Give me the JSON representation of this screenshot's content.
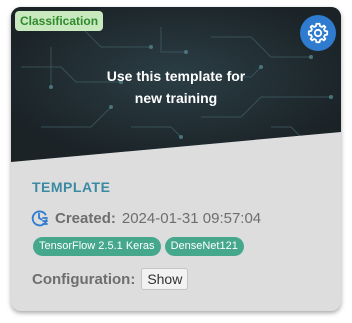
{
  "card": {
    "badge": "Classification",
    "banner_text_line1": "Use this template for",
    "banner_text_line2": "new training",
    "settings_icon": "gear-icon",
    "title": "TEMPLATE",
    "created_label": "Created:",
    "created_value": "2024-01-31 09:57:04",
    "created_icon": "clock-list-icon",
    "tags": [
      "TensorFlow 2.5.1 Keras",
      "DenseNet121"
    ],
    "config_label": "Configuration:",
    "config_button": "Show"
  },
  "colors": {
    "banner_bg": "#1f282c",
    "badge_bg": "#c8e8be",
    "badge_text": "#2e8a2c",
    "gear_bg": "#2f7bd0",
    "title": "#3b8aa3",
    "tag_bg": "#45a88c",
    "card_bg": "#dddddd"
  }
}
